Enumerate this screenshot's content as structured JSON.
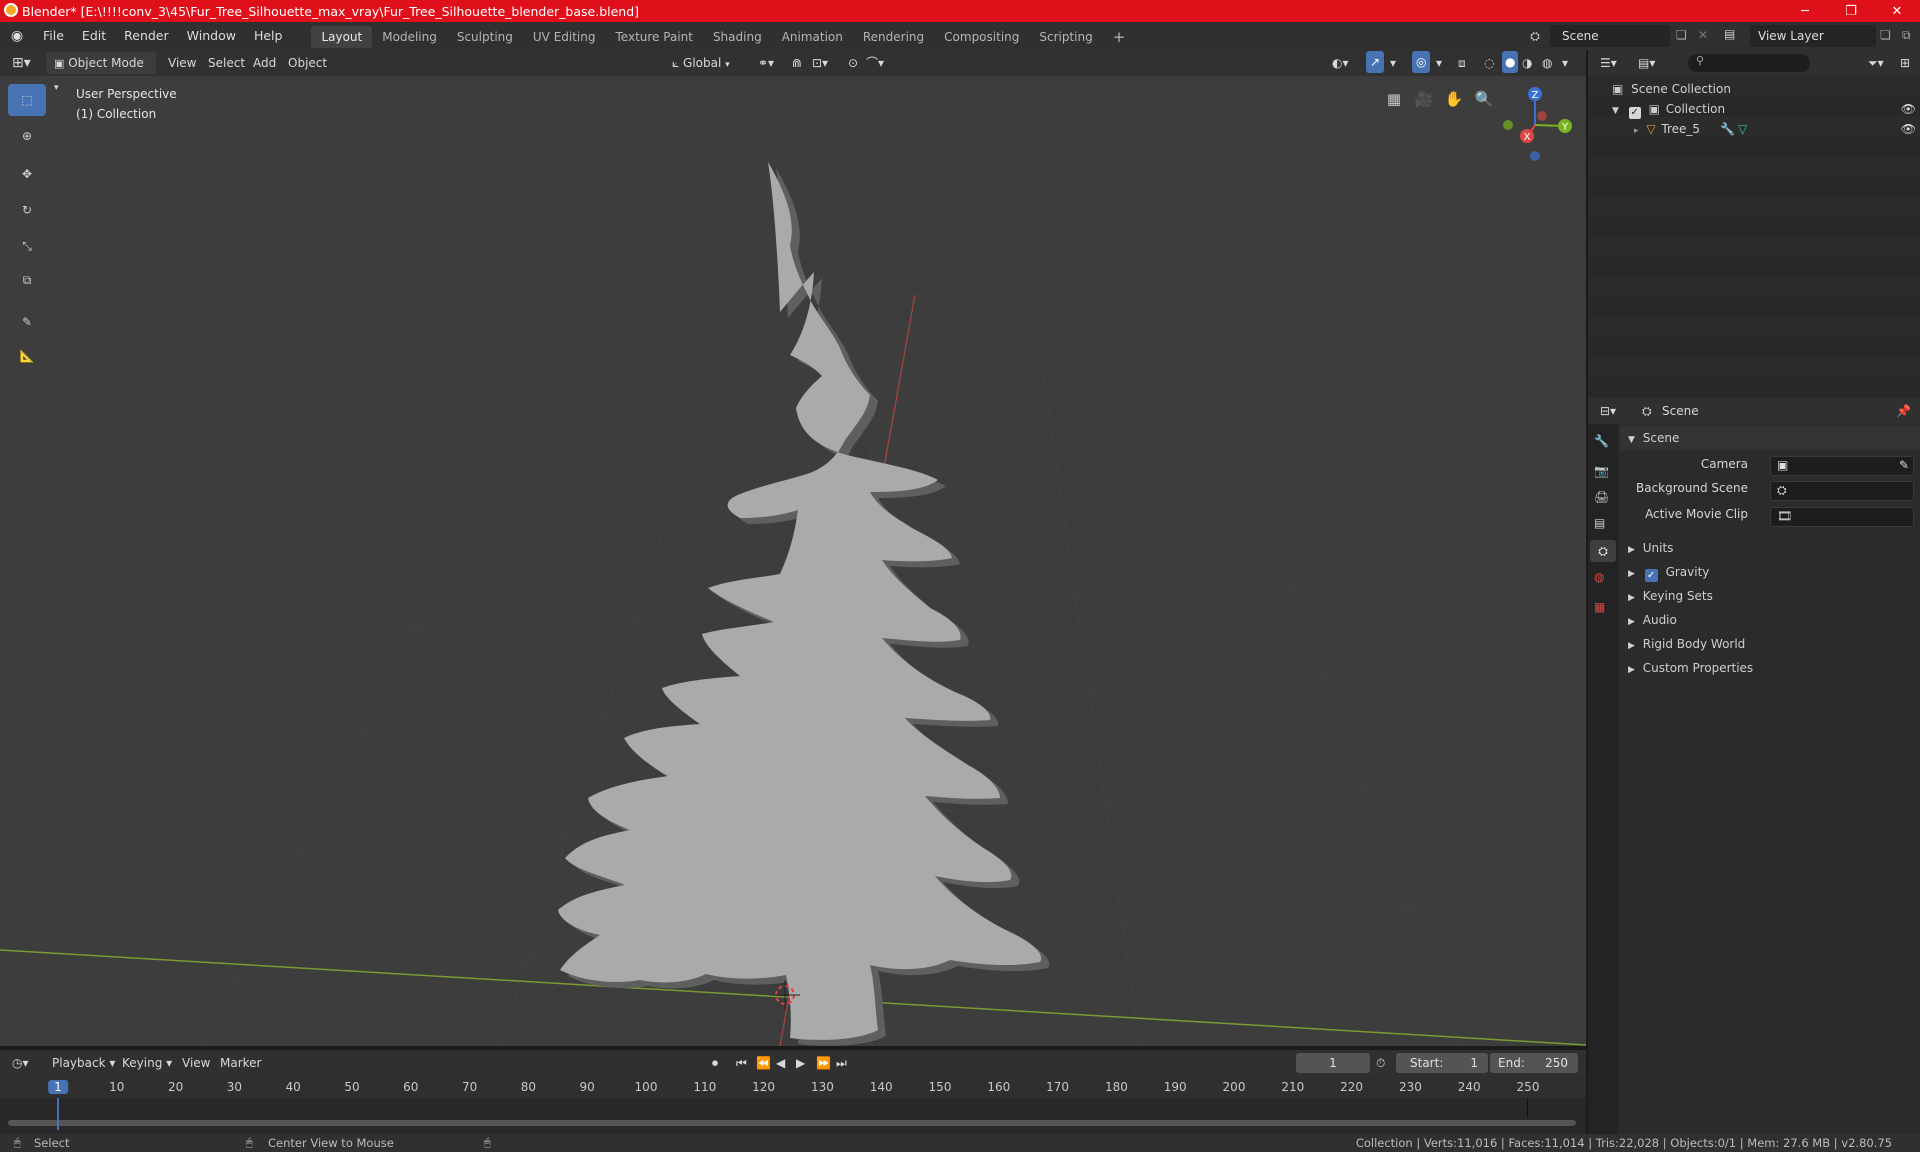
{
  "title_bar": {
    "title": "Blender* [E:\\!!!!conv_3\\45\\Fur_Tree_Silhouette_max_vray\\Fur_Tree_Silhouette_blender_base.blend]",
    "minimize": "─",
    "maximize": "❐",
    "close": "✕"
  },
  "menus": [
    "File",
    "Edit",
    "Render",
    "Window",
    "Help"
  ],
  "workspaces": [
    "Layout",
    "Modeling",
    "Sculpting",
    "UV Editing",
    "Texture Paint",
    "Shading",
    "Animation",
    "Rendering",
    "Compositing",
    "Scripting"
  ],
  "add_workspace": "+",
  "scene_selector": {
    "value": "Scene"
  },
  "view_layer_selector": {
    "value": "View Layer"
  },
  "viewport_header": {
    "mode": "Object Mode",
    "menus": [
      "View",
      "Select",
      "Add",
      "Object"
    ],
    "orientation": "Global"
  },
  "viewport": {
    "overlay_line1": "User Perspective",
    "overlay_line2": "(1) Collection",
    "gizmo": {
      "z": "Z",
      "y": "Y",
      "x": "X"
    },
    "colors": {
      "background": "#3d3d3d",
      "x_axis": "#a84545",
      "y_axis": "#7a9a33",
      "object": "#a9abab"
    }
  },
  "outliner": {
    "root": "Scene Collection",
    "collection": "Collection",
    "object": "Tree_5"
  },
  "properties": {
    "header": "Scene",
    "panel": "Scene",
    "fields": [
      {
        "label": "Camera"
      },
      {
        "label": "Background Scene"
      },
      {
        "label": "Active Movie Clip"
      }
    ],
    "sections": [
      "Units",
      "Gravity",
      "Keying Sets",
      "Audio",
      "Rigid Body World",
      "Custom Properties"
    ],
    "gravity_checked": true
  },
  "timeline": {
    "menus": [
      "Playback",
      "Keying",
      "View",
      "Marker"
    ],
    "current_frame": "1",
    "start_label": "Start:",
    "start_value": "1",
    "end_label": "End:",
    "end_value": "250",
    "ticks": [
      "1",
      "10",
      "20",
      "30",
      "40",
      "50",
      "60",
      "70",
      "80",
      "90",
      "100",
      "110",
      "120",
      "130",
      "140",
      "150",
      "160",
      "170",
      "180",
      "190",
      "200",
      "210",
      "220",
      "230",
      "240",
      "250"
    ]
  },
  "status_bar": {
    "left1": "Select",
    "left2": "Center View to Mouse",
    "right": "Collection | Verts:11,016 | Faces:11,014 | Tris:22,028 | Objects:0/1 | Mem: 27.6 MB | v2.80.75"
  },
  "accent": "#4772b3"
}
